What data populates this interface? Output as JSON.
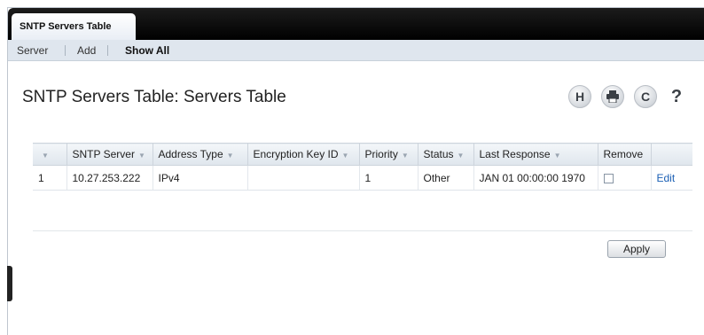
{
  "tab": {
    "label": "SNTP Servers Table"
  },
  "subnav": {
    "items": [
      {
        "label": "Server"
      },
      {
        "label": "Add"
      },
      {
        "label": "Show All"
      }
    ]
  },
  "page": {
    "title": "SNTP Servers Table: Servers Table"
  },
  "toolbar": {
    "icons": [
      "save-icon",
      "print-icon",
      "refresh-icon",
      "help-icon"
    ],
    "save_glyph": "H",
    "refresh_glyph": "C",
    "help_glyph": "?"
  },
  "table": {
    "columns": [
      "",
      "SNTP Server",
      "Address Type",
      "Encryption Key ID",
      "Priority",
      "Status",
      "Last Response",
      "Remove",
      ""
    ],
    "rows": [
      {
        "index": "1",
        "server": "10.27.253.222",
        "address_type": "IPv4",
        "encryption_key_id": "",
        "priority": "1",
        "status": "Other",
        "last_response": "JAN 01 00:00:00 1970",
        "remove_checked": false,
        "edit_label": "Edit"
      }
    ]
  },
  "actions": {
    "apply_label": "Apply"
  }
}
